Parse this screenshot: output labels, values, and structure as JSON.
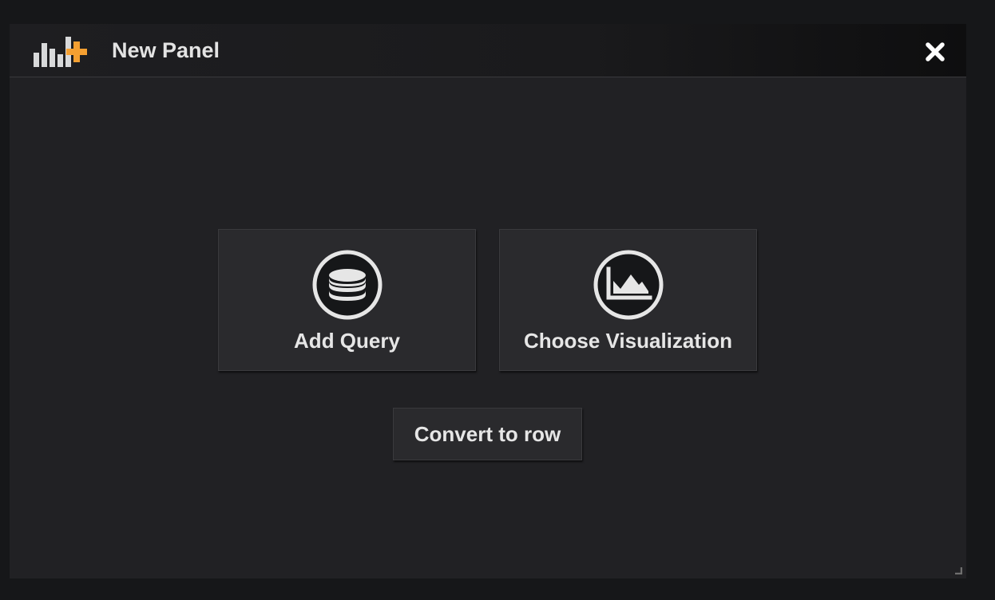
{
  "panel": {
    "title": "New Panel",
    "header_icon": "add-panel-icon",
    "close_icon": "close-icon",
    "accent_color": "#f5a031"
  },
  "actions": [
    {
      "label": "Add Query",
      "icon": "database-icon"
    },
    {
      "label": "Choose Visualization",
      "icon": "area-chart-icon"
    }
  ],
  "convert": {
    "label": "Convert to row"
  },
  "resize_icon": "resize-handle-icon"
}
